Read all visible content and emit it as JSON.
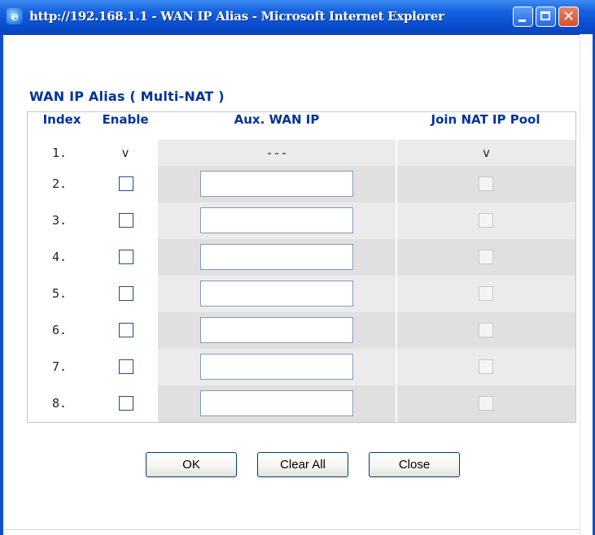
{
  "window": {
    "title": "http://192.168.1.1 - WAN IP Alias - Microsoft Internet Explorer",
    "app_icon": "e",
    "controls": {
      "minimize": "minimize-icon",
      "maximize": "maximize-icon",
      "close": "✕"
    }
  },
  "heading": "WAN IP Alias ( Multi-NAT )",
  "table": {
    "headers": {
      "index": "Index",
      "enable": "Enable",
      "aux_ip": "Aux. WAN IP",
      "join_pool": "Join NAT IP Pool"
    },
    "first_row": {
      "index": "1.",
      "enable": "v",
      "aux_ip": "---",
      "join_pool": "v"
    },
    "rows": [
      {
        "index": "2.",
        "enabled": false,
        "ip": "",
        "join": false
      },
      {
        "index": "3.",
        "enabled": false,
        "ip": "",
        "join": false
      },
      {
        "index": "4.",
        "enabled": false,
        "ip": "",
        "join": false
      },
      {
        "index": "5.",
        "enabled": false,
        "ip": "",
        "join": false
      },
      {
        "index": "6.",
        "enabled": false,
        "ip": "",
        "join": false
      },
      {
        "index": "7.",
        "enabled": false,
        "ip": "",
        "join": false
      },
      {
        "index": "8.",
        "enabled": false,
        "ip": "",
        "join": false
      }
    ]
  },
  "buttons": {
    "ok": "OK",
    "clear_all": "Clear All",
    "close": "Close"
  },
  "colors": {
    "titlebar": "#0a4fd0",
    "heading": "#003399",
    "row_shade": "#e0e0e0"
  }
}
